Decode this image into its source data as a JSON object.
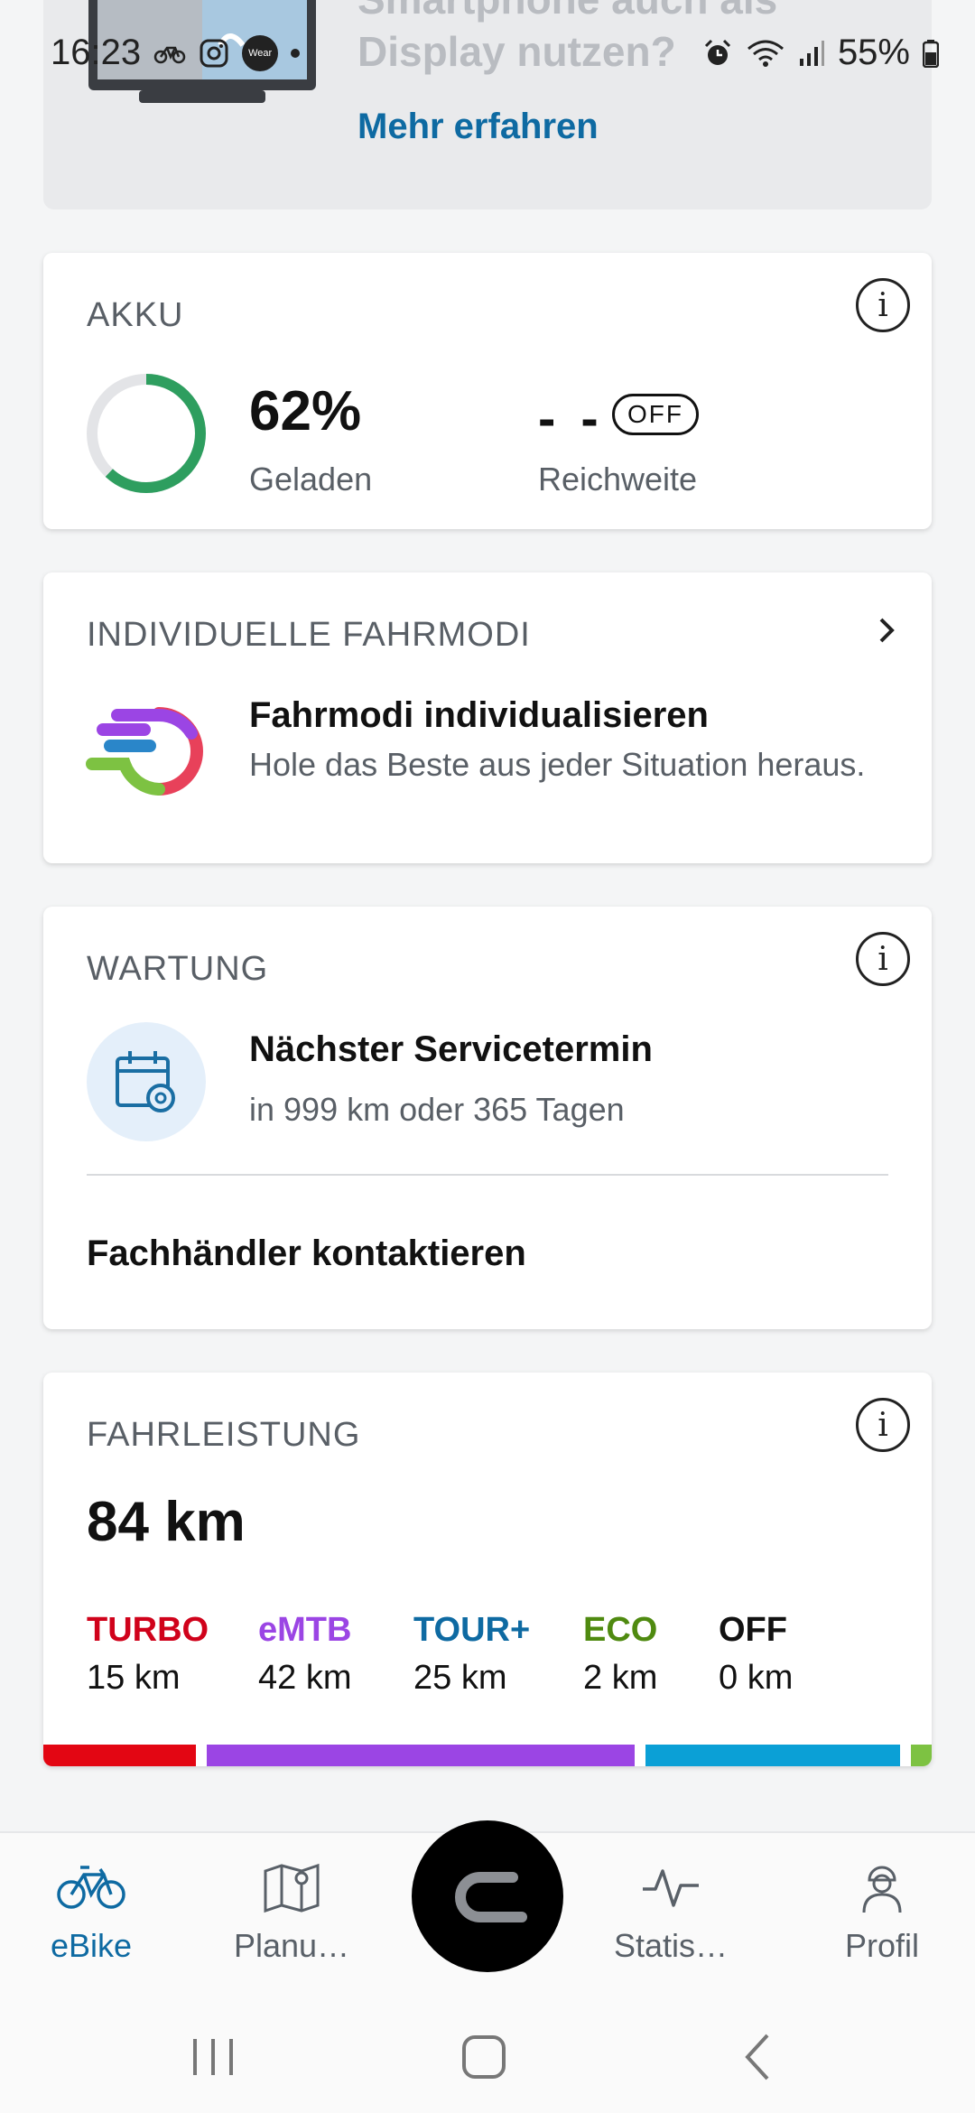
{
  "status_bar": {
    "time": "16:23",
    "wear_label": "Wear",
    "battery": "55%"
  },
  "promo": {
    "title": "Smartphone auch als Display nutzen?",
    "link": "Mehr erfahren"
  },
  "akku": {
    "title": "AKKU",
    "percent_text": "62%",
    "charge_fraction": 0.62,
    "percent_label": "Geladen",
    "range_value": "- -",
    "range_badge": "OFF",
    "range_label": "Reichweite"
  },
  "fahrmodi": {
    "title": "INDIVIDUELLE FAHRMODI",
    "heading": "Fahrmodi individualisieren",
    "description": "Hole das Beste aus jeder Situation heraus."
  },
  "wartung": {
    "title": "WARTUNG",
    "heading": "Nächster Servicetermin",
    "subtext": "in 999 km oder 365 Tagen",
    "dealer_link": "Fachhändler kontaktieren"
  },
  "fahrleistung": {
    "title": "FAHRLEISTUNG",
    "total": "84 km",
    "modes": [
      {
        "name": "TURBO",
        "distance": "15 km",
        "km": 15,
        "color": "#d0021b"
      },
      {
        "name": "eMTB",
        "distance": "42 km",
        "km": 42,
        "color": "#9b45e4"
      },
      {
        "name": "TOUR+",
        "distance": "25 km",
        "km": 25,
        "color": "#0e6aa2"
      },
      {
        "name": "ECO",
        "distance": "2 km",
        "km": 2,
        "color": "#4f8a10"
      },
      {
        "name": "OFF",
        "distance": "0 km",
        "km": 0,
        "color": "#111111"
      }
    ],
    "bar_colors": [
      "#e30613",
      "#9b45e4",
      "#0ba0d6",
      "#7dc242"
    ]
  },
  "bottom_nav": {
    "items": [
      {
        "label": "eBike",
        "active": true
      },
      {
        "label": "Planu…",
        "active": false
      },
      {
        "label": "Statis…",
        "active": false
      },
      {
        "label": "Profil",
        "active": false
      }
    ]
  },
  "colors": {
    "accent": "#0e6aa2",
    "battery_ring": "#2e9e5f",
    "ring_track": "#e3e4e7"
  }
}
